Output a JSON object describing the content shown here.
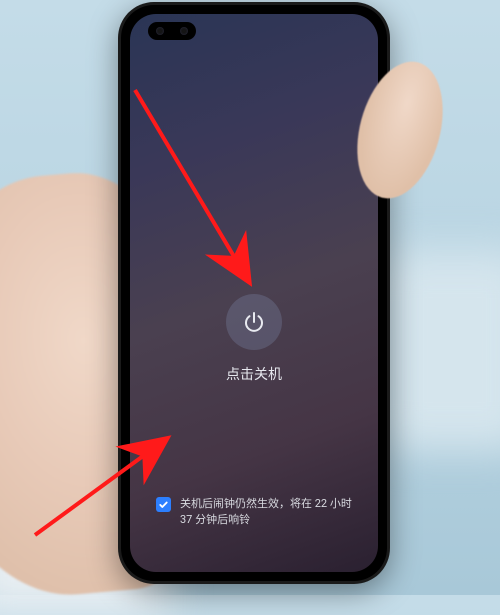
{
  "power": {
    "button_label": "点击关机",
    "icon_name": "power-icon"
  },
  "alarm": {
    "checked": true,
    "text": "关机后闹钟仍然生效，将在 22 小时 37 分钟后响铃"
  },
  "annotation": {
    "arrow_color": "#ff1a1a"
  }
}
